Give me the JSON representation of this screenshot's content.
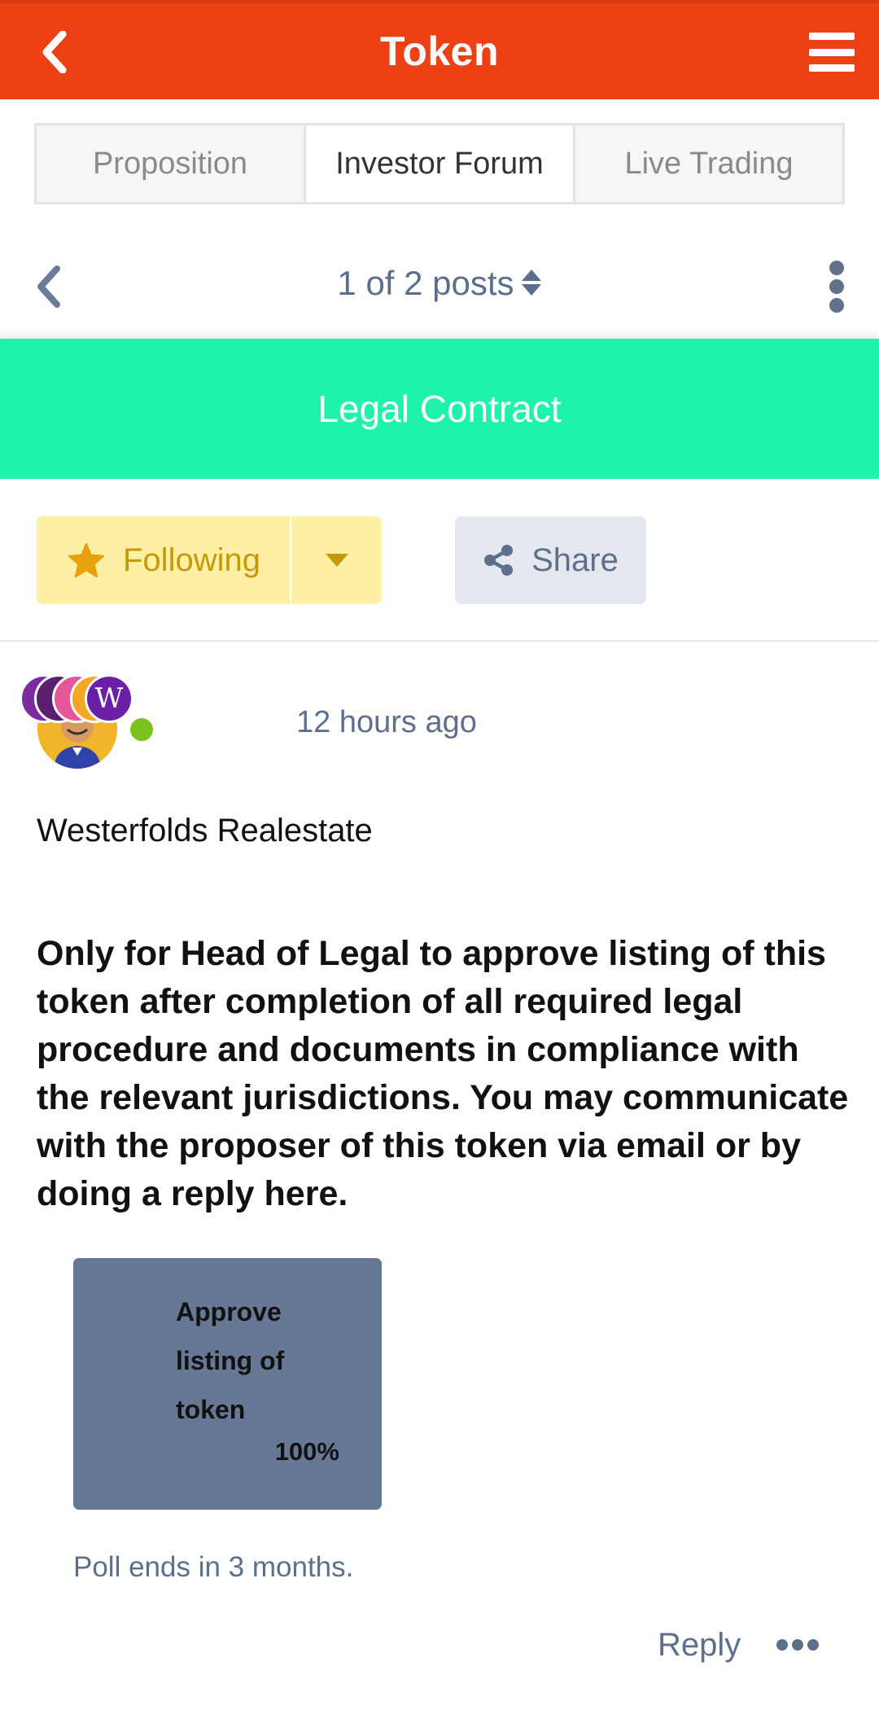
{
  "header": {
    "title": "Token",
    "back_icon": "chevron-left-icon",
    "menu_icon": "hamburger-menu-icon",
    "color": "#eb4115"
  },
  "tabs": [
    {
      "label": "Proposition",
      "active": false
    },
    {
      "label": "Investor Forum",
      "active": true
    },
    {
      "label": "Live Trading",
      "active": false
    }
  ],
  "post_nav": {
    "counter": "1 of 2 posts",
    "prev_icon": "chevron-left-icon",
    "sort_icon": "sort-icon",
    "more_icon": "kebab-menu-icon"
  },
  "banner": {
    "title": "Legal Contract",
    "color": "#1ff3ab"
  },
  "actions": {
    "follow_label": "Following",
    "follow_icon": "star-icon",
    "dropdown_icon": "caret-down-icon",
    "share_label": "Share",
    "share_icon": "share-icon"
  },
  "post": {
    "time": "12 hours ago",
    "author": "Westerfolds Realestate",
    "mini_avatar_letter": "W",
    "body": "Only for Head of Legal to approve listing of this token after completion of all required legal procedure and documents in compliance with the relevant jurisdictions. You may communicate with the proposer of this token via email or by doing a reply here."
  },
  "poll": {
    "option": "Approve listing of token",
    "percent": "100%",
    "ends": "Poll ends in 3 months."
  },
  "footer": {
    "reply_label": "Reply",
    "more_icon": "ellipsis-icon"
  }
}
